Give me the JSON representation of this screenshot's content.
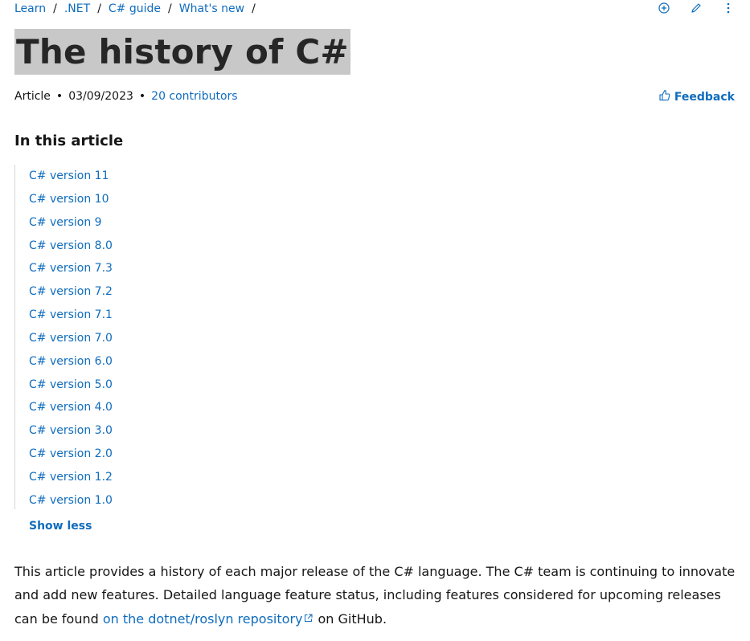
{
  "breadcrumb": {
    "items": [
      "Learn",
      ".NET",
      "C# guide",
      "What's new"
    ],
    "separator": "/"
  },
  "top_actions": {
    "icons": [
      "add-circle-icon",
      "edit-pencil-icon",
      "more-vertical-icon"
    ]
  },
  "page_title": "The history of C#",
  "meta": {
    "type": "Article",
    "date": "03/09/2023",
    "contributors": "20 contributors",
    "dot": "•"
  },
  "feedback": {
    "label": "Feedback",
    "icon": "thumbs-up-icon"
  },
  "toc": {
    "heading": "In this article",
    "items": [
      "C# version 11",
      "C# version 10",
      "C# version 9",
      "C# version 8.0",
      "C# version 7.3",
      "C# version 7.2",
      "C# version 7.1",
      "C# version 7.0",
      "C# version 6.0",
      "C# version 5.0",
      "C# version 4.0",
      "C# version 3.0",
      "C# version 2.0",
      "C# version 1.2",
      "C# version 1.0"
    ],
    "show_less": "Show less"
  },
  "intro": {
    "text_before": "This article provides a history of each major release of the C# language. The C# team is continuing to innovate and add new features. Detailed language feature status, including features considered for upcoming releases can be found ",
    "link_text": "on the dotnet/roslyn repository",
    "text_after": "on GitHub."
  },
  "colors": {
    "link": "#0f6cbd",
    "text": "#161616",
    "title_highlight": "#c8c8c8"
  }
}
